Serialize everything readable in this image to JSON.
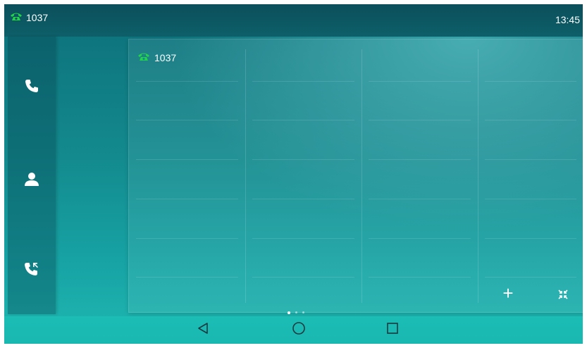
{
  "status_bar": {
    "line_label": "1037",
    "time": "13:45"
  },
  "sidebar": {
    "items": [
      {
        "name": "dialer",
        "icon": "phone-handset-icon"
      },
      {
        "name": "directory",
        "icon": "contact-person-icon"
      },
      {
        "name": "call-history",
        "icon": "call-history-icon"
      }
    ]
  },
  "dsskey_panel": {
    "line_key_label": "1037",
    "add_button": "+",
    "page_indicator": {
      "pages": 3,
      "active": 0
    }
  },
  "navigation": {
    "buttons": [
      "back-triangle-icon",
      "home-circle-icon",
      "recent-apps-square-icon"
    ]
  },
  "colors": {
    "registered_green": "#22d447",
    "status_bar": "#0b4f5b",
    "nav_bar": "#1bbdb5"
  }
}
